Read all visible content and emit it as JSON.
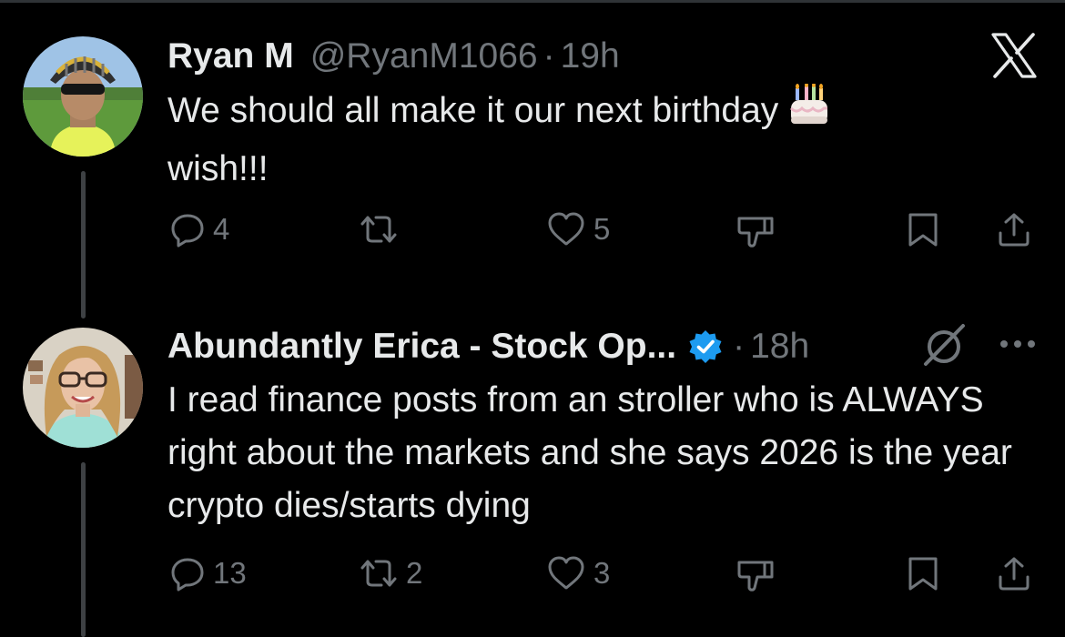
{
  "posts": [
    {
      "name": "Ryan M",
      "handle": "@RyanM1066",
      "separator": "·",
      "time": "19h",
      "text": "We should all make it our next birthday",
      "text_end": "wish!!!",
      "emoji": "birthday-cake",
      "corner_icon": "x-logo-icon",
      "verified": false,
      "actions": {
        "replies": "4",
        "reposts": "",
        "likes": "5",
        "downvote": "",
        "bookmark": "",
        "share": ""
      }
    },
    {
      "name": "Abundantly Erica - Stock Op...",
      "handle": "",
      "separator": "·",
      "time": "18h",
      "text": "I read finance posts from an stroller who is ALWAYS right about the markets and she says 2026 is the year crypto dies/starts dying",
      "corner_icon": "grok-icon",
      "more_icon": "more-horizontal-icon",
      "verified": true,
      "verified_color": "#1d9bf0",
      "actions": {
        "replies": "13",
        "reposts": "2",
        "likes": "3",
        "downvote": "",
        "bookmark": "",
        "share": ""
      }
    }
  ],
  "colors": {
    "background": "#000000",
    "text": "#e7e9ea",
    "muted": "#71767b",
    "thread_line": "#3e4144"
  }
}
